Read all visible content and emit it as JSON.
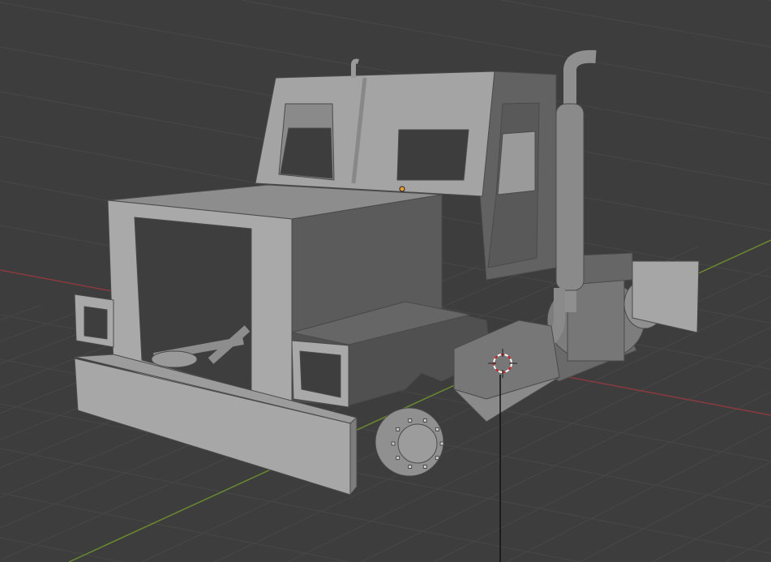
{
  "viewport": {
    "background_color": "#3d3d3d",
    "grid_color": "#474747",
    "x_axis_color": "#8a3a3f",
    "y_axis_color": "#6a8a2f",
    "model_light": "#a9a9a9",
    "model_mid": "#8c8c8c",
    "model_dark": "#5e5e5e",
    "origin_color": "#f0a030",
    "cursor_color": "#d02020"
  }
}
